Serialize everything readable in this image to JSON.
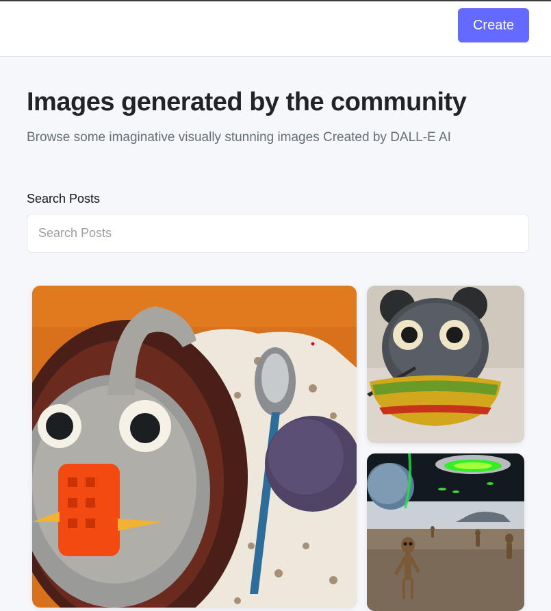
{
  "header": {
    "create_label": "Create",
    "accent_color": "#6469ff"
  },
  "hero": {
    "title": "Images generated by the community",
    "subtitle": "Browse some imaginative visually stunning images Created by DALL-E AI"
  },
  "search": {
    "label": "Search Posts",
    "placeholder": "Search Posts",
    "value": ""
  },
  "gallery": {
    "cards": [
      {
        "depicts": "knitted yarn monster in a bowl with spoon and yarn ball on a lace doily"
      },
      {
        "depicts": "knitted black creature with big eyes in a yellow woven bowl"
      },
      {
        "depicts": "aliens walking on a barren planet beneath a green-glowing flying saucer"
      }
    ]
  }
}
